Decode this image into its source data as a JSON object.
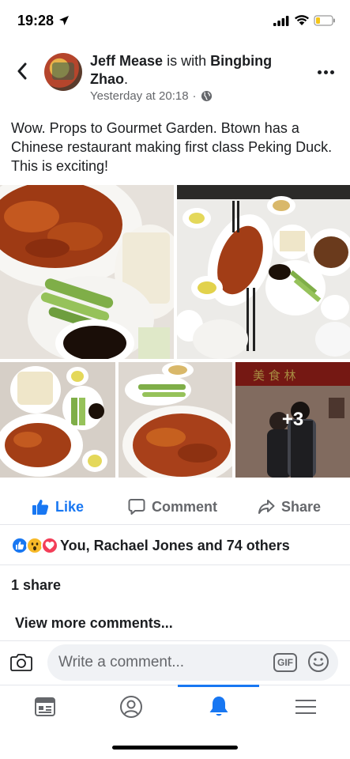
{
  "status_bar": {
    "time": "19:28"
  },
  "post": {
    "author": "Jeff Mease",
    "with_text": "is with",
    "tagged": "Bingbing Zhao",
    "timestamp": "Yesterday at 20:18",
    "separator": "·",
    "privacy_icon": "globe-icon",
    "text": "Wow.  Props to Gourmet Garden.  Btown has a Chinese restaurant making first class Peking Duck.  This is exciting!",
    "more_photos": "+3"
  },
  "actions": {
    "like": "Like",
    "comment": "Comment",
    "share": "Share"
  },
  "reactions": {
    "icons": [
      "like-reaction-icon",
      "wow-reaction-icon",
      "love-reaction-icon"
    ],
    "summary": "You, Rachael Jones and 74 others"
  },
  "shares": "1 share",
  "view_more": "View more comments...",
  "comment_bar": {
    "placeholder": "Write a comment...",
    "gif": "GIF"
  },
  "nav": {
    "items": [
      "news-feed-icon",
      "profile-icon",
      "notifications-icon",
      "menu-icon"
    ],
    "active": "notifications-icon"
  },
  "colors": {
    "accent": "#1877f2",
    "text": "#1c1e21",
    "secondary": "#65676b",
    "love": "#f33e58",
    "wow": "#f7b928"
  }
}
